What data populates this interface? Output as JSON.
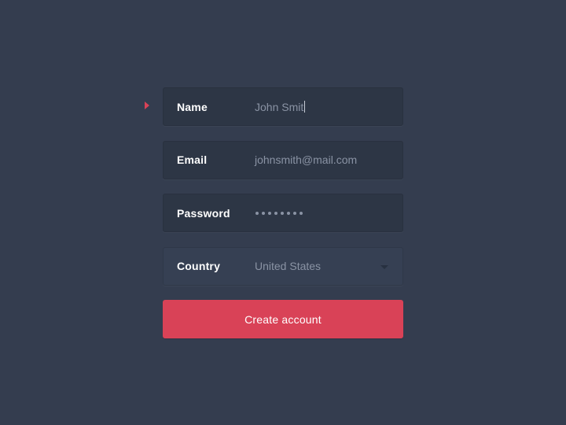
{
  "form": {
    "active_field": "name",
    "fields": [
      {
        "id": "name",
        "label": "Name",
        "value": "John Smit",
        "type": "text"
      },
      {
        "id": "email",
        "label": "Email",
        "value": "johnsmith@mail.com",
        "type": "email"
      },
      {
        "id": "password",
        "label": "Password",
        "value_masked_length": 8,
        "type": "password"
      },
      {
        "id": "country",
        "label": "Country",
        "value": "United States",
        "type": "select"
      }
    ],
    "submit_label": "Create account"
  },
  "colors": {
    "background": "#343d4f",
    "input_background": "#2d3645",
    "accent": "#d94257",
    "label_text": "#ffffff",
    "value_text": "#8a93a4"
  }
}
